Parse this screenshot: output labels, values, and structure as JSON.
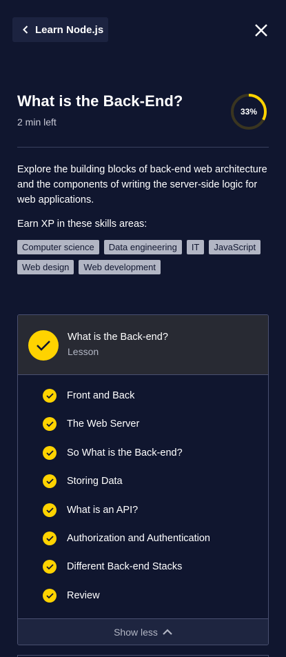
{
  "nav": {
    "back_label": "Learn Node.js",
    "back_icon": "chevron-left-icon",
    "close_icon": "close-icon"
  },
  "header": {
    "title": "What is the Back-End?",
    "time_left": "2 min left",
    "progress_label": "33%",
    "progress_value": 0.33
  },
  "description": "Explore the building blocks of back-end web architecture and the components of writing the server-side logic for web applications.",
  "skills": {
    "label": "Earn XP in these skills areas:",
    "tags": [
      "Computer science",
      "Data engineering",
      "IT",
      "JavaScript",
      "Web design",
      "Web development"
    ]
  },
  "lesson": {
    "title": "What is the Back-end?",
    "type": "Lesson",
    "items": [
      "Front and Back",
      "The Web Server",
      "So What is the Back-end?",
      "Storing Data",
      "What is an API?",
      "Authorization and Authentication",
      "Different Back-end Stacks",
      "Review"
    ],
    "show_less_label": "Show less"
  },
  "colors": {
    "background": "#10162f",
    "accent": "#ffd300",
    "tag_bg": "#b2b6c4",
    "card_header_bg": "#282a33"
  }
}
